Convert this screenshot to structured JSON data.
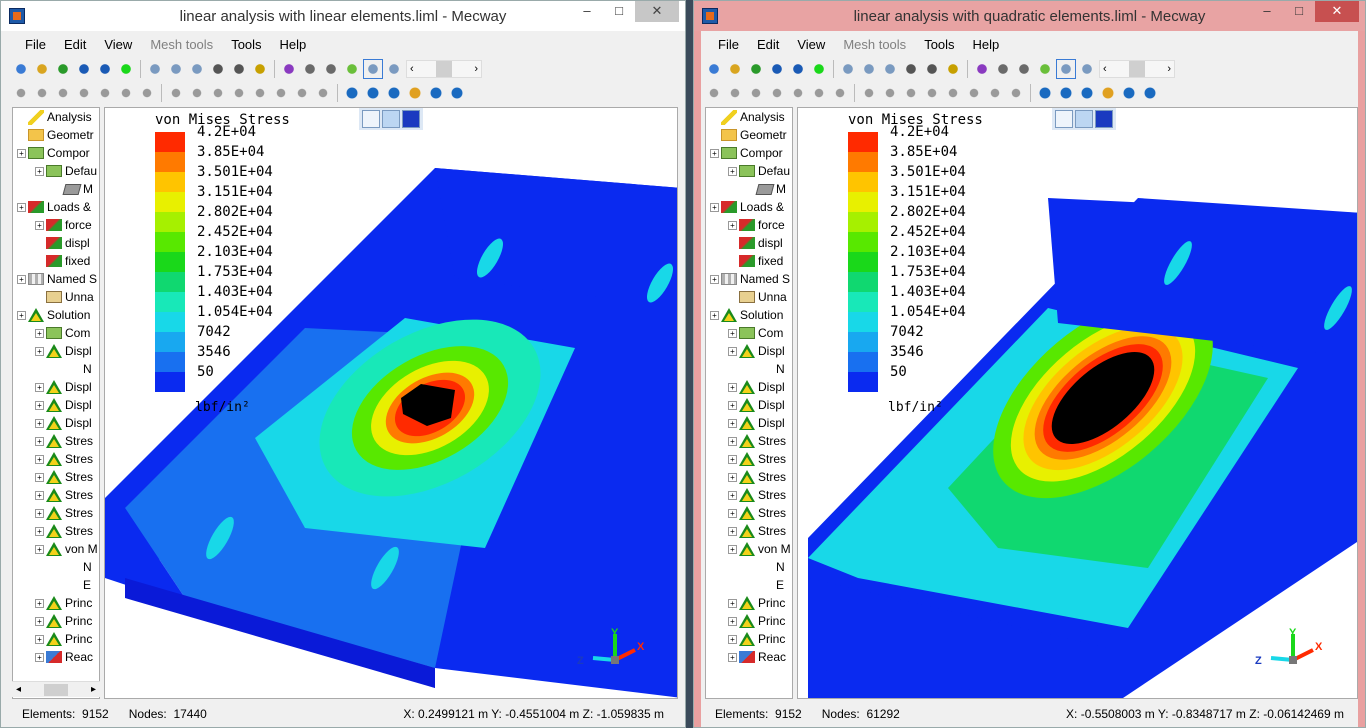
{
  "menus": [
    "File",
    "Edit",
    "View",
    "Mesh tools",
    "Tools",
    "Help"
  ],
  "disabled_menu": "Mesh tools",
  "legend": {
    "title": "von Mises Stress",
    "unit": "lbf/in²",
    "labels": [
      "4.2E+04",
      "3.85E+04",
      "3.501E+04",
      "3.151E+04",
      "2.802E+04",
      "2.452E+04",
      "2.103E+04",
      "1.753E+04",
      "1.403E+04",
      "1.054E+04",
      "7042",
      "3546",
      "50"
    ],
    "colors": [
      "#ff2a00",
      "#ff7a00",
      "#ffc400",
      "#e8f000",
      "#a6f000",
      "#58e800",
      "#1ad81a",
      "#10d870",
      "#18e8b8",
      "#18d8e8",
      "#18a8f0",
      "#1870f0",
      "#0a2af0"
    ]
  },
  "tree": {
    "items": [
      {
        "label": "Analysis",
        "icon": "pencil-icon",
        "plus": false
      },
      {
        "label": "Geometr",
        "icon": "folder-icon",
        "plus": false
      },
      {
        "label": "Compor",
        "icon": "component-icon",
        "plus": true
      },
      {
        "label": "Defau",
        "icon": "component-icon",
        "plus": true
      },
      {
        "label": "M",
        "icon": "material-icon",
        "plus": false
      },
      {
        "label": "Loads &",
        "icon": "loads-icon",
        "plus": true
      },
      {
        "label": "force",
        "icon": "force-icon",
        "plus": true
      },
      {
        "label": "displ",
        "icon": "force-icon",
        "plus": false
      },
      {
        "label": "fixed",
        "icon": "force-icon",
        "plus": false
      },
      {
        "label": "Named S",
        "icon": "named-set-icon",
        "plus": true
      },
      {
        "label": "Unna",
        "icon": "solid-icon",
        "plus": false
      },
      {
        "label": "Solution",
        "icon": "solution-icon",
        "plus": true
      },
      {
        "label": "Com",
        "icon": "component-icon",
        "plus": true
      },
      {
        "label": "Displ",
        "icon": "result-icon",
        "plus": true
      },
      {
        "label": "N",
        "icon": "none",
        "plus": false
      },
      {
        "label": "Displ",
        "icon": "result-icon",
        "plus": true
      },
      {
        "label": "Displ",
        "icon": "result-icon",
        "plus": true
      },
      {
        "label": "Displ",
        "icon": "result-icon",
        "plus": true
      },
      {
        "label": "Stres",
        "icon": "result-icon",
        "plus": true
      },
      {
        "label": "Stres",
        "icon": "result-icon",
        "plus": true
      },
      {
        "label": "Stres",
        "icon": "result-icon",
        "plus": true
      },
      {
        "label": "Stres",
        "icon": "result-icon",
        "plus": true
      },
      {
        "label": "Stres",
        "icon": "result-icon",
        "plus": true
      },
      {
        "label": "Stres",
        "icon": "result-icon",
        "plus": true
      },
      {
        "label": "von M",
        "icon": "result-icon",
        "plus": true
      },
      {
        "label": "N",
        "icon": "none",
        "plus": false
      },
      {
        "label": "E",
        "icon": "none",
        "plus": false
      },
      {
        "label": "Princ",
        "icon": "result-icon",
        "plus": true
      },
      {
        "label": "Princ",
        "icon": "result-icon",
        "plus": true
      },
      {
        "label": "Princ",
        "icon": "result-icon",
        "plus": true
      },
      {
        "label": "Reac",
        "icon": "reaction-icon",
        "plus": true
      }
    ]
  },
  "left": {
    "title": "linear analysis with linear elements.liml - Mecway",
    "elements_label": "Elements:",
    "elements": "9152",
    "nodes_label": "Nodes:",
    "nodes": "17440",
    "coords": "X: 0.2499121 m Y: -0.4551004 m Z: -1.059835 m"
  },
  "right": {
    "title": "linear analysis with quadratic elements.liml - Mecway",
    "elements_label": "Elements:",
    "elements": "9152",
    "nodes_label": "Nodes:",
    "nodes": "61292",
    "coords": "X: -0.5508003 m Y: -0.8348717 m Z: -0.06142469 m"
  },
  "axes": {
    "x": "X",
    "y": "Y",
    "z": "Z"
  },
  "window_buttons": {
    "minimize": "–",
    "maximize": "□",
    "close": "✕"
  }
}
